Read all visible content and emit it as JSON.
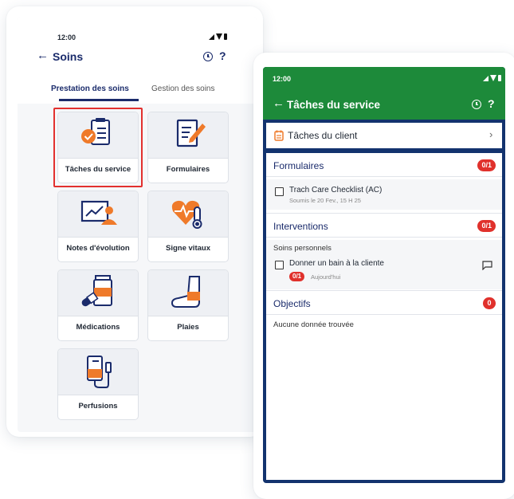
{
  "colors": {
    "navy": "#1a2b6b",
    "green": "#1d8a3a",
    "red": "#e0312c",
    "orange": "#ef7a2a"
  },
  "left_phone": {
    "status_time": "12:00",
    "title": "Soins",
    "tabs": [
      "Prestation des soins",
      "Gestion des soins"
    ],
    "tiles": [
      {
        "label": "Tâches du service",
        "icon": "checklist-icon"
      },
      {
        "label": "Formulaires",
        "icon": "form-edit-icon"
      },
      {
        "label": "Notes d'évolution",
        "icon": "progress-chart-icon"
      },
      {
        "label": "Signe vitaux",
        "icon": "heart-thermometer-icon"
      },
      {
        "label": "Médications",
        "icon": "pill-bottle-icon"
      },
      {
        "label": "Plaies",
        "icon": "foot-bandage-icon"
      },
      {
        "label": "Perfusions",
        "icon": "iv-bag-icon"
      }
    ]
  },
  "right_phone": {
    "status_time": "12:00",
    "title": "Tâches du service",
    "client_tasks": "Tâches du client",
    "sections": {
      "formulaires": {
        "title": "Formulaires",
        "badge": "0/1",
        "item_title": "Trach Care Checklist (AC)",
        "item_sub": "Soumis le 20 Fev., 15 H 25"
      },
      "interventions": {
        "title": "Interventions",
        "badge": "0/1",
        "group": "Soins personnels",
        "item_title": "Donner un bain à la cliente",
        "item_badge": "0/1",
        "item_sub": "Aujourd'hui"
      },
      "objectifs": {
        "title": "Objectifs",
        "badge": "0",
        "empty": "Aucune donnée trouvée"
      }
    }
  }
}
